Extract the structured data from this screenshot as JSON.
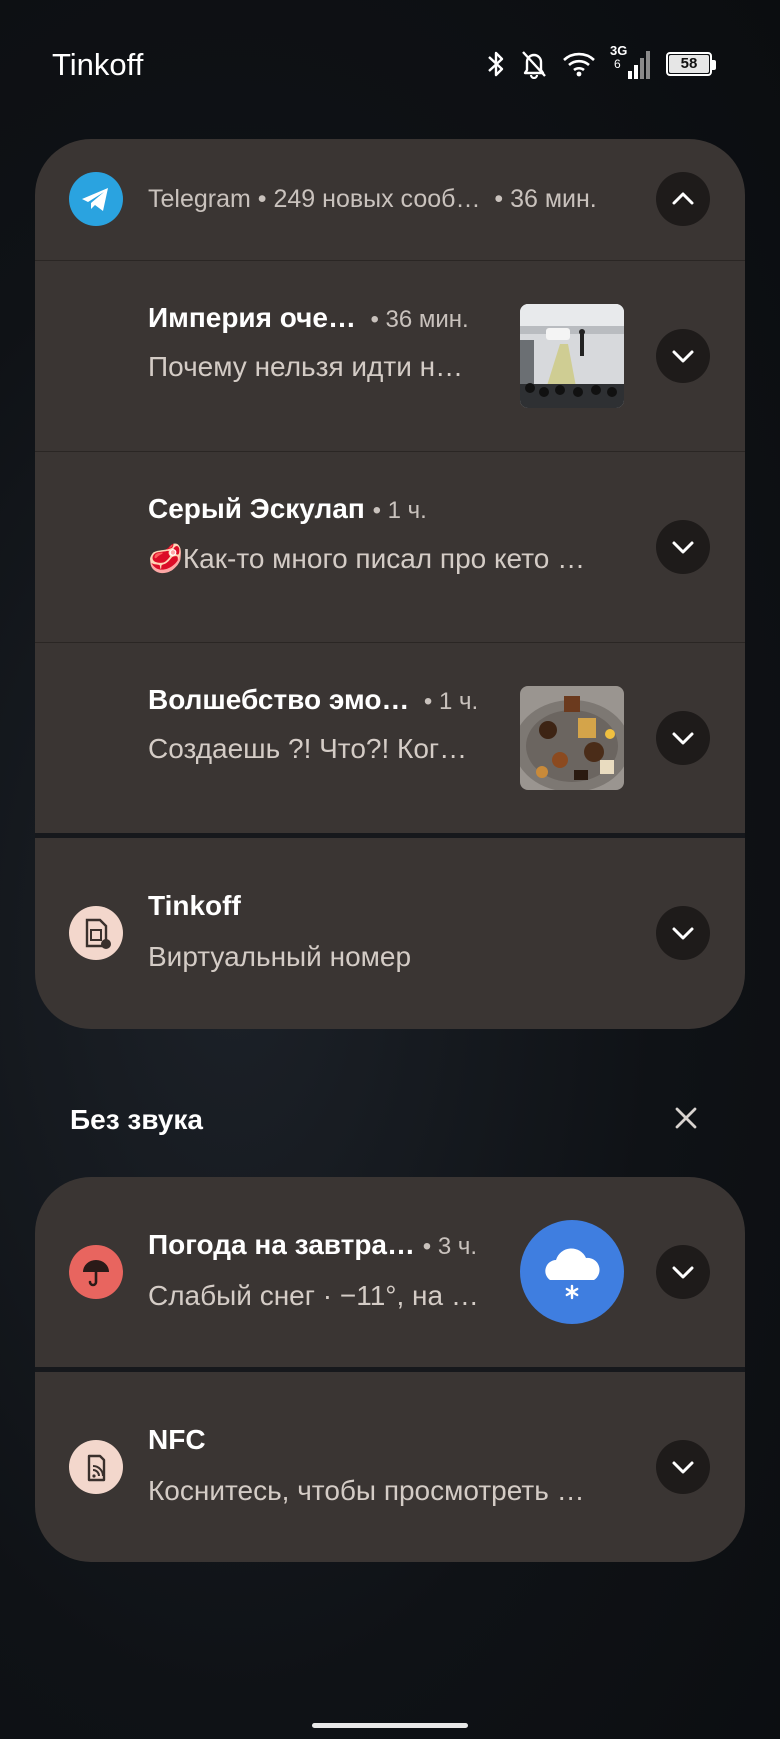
{
  "status_bar": {
    "carrier": "Tinkoff",
    "network": "3G",
    "network_sub": "6",
    "battery": "58",
    "icons": [
      "bluetooth-icon",
      "bell-off-icon",
      "wifi-icon",
      "signal-icon",
      "battery-icon"
    ]
  },
  "telegram_group": {
    "app": "Telegram",
    "summary": "249 новых сооб…",
    "time": "36 мин.",
    "messages": [
      {
        "title": "Империя оче…",
        "time": "36 мин.",
        "body": "Почему нельзя идти н…",
        "has_thumbnail": true
      },
      {
        "title": "Серый Эскулап",
        "time": "1 ч.",
        "body": "🥩Как-то много писал про кето …",
        "has_thumbnail": false
      },
      {
        "title": "Волшебство эмо…",
        "time": "1 ч.",
        "body": "Создаешь ?! Что?! Ког…",
        "has_thumbnail": true
      }
    ]
  },
  "tinkoff_notification": {
    "title": "Tinkoff",
    "body": "Виртуальный номер"
  },
  "silent_section": {
    "label": "Без звука"
  },
  "weather_notification": {
    "title": "Погода на завтра…",
    "time": "3 ч.",
    "body": "Слабый снег · −11°, на …"
  },
  "nfc_notification": {
    "title": "NFC",
    "body": "Коснитесь, чтобы просмотреть …"
  },
  "colors": {
    "telegram": "#2aa3e0",
    "card": "#3a3533",
    "weather_icon": "#e8655f",
    "weather_badge": "#3f7ee0",
    "badge_bg": "#f3d7cc"
  }
}
